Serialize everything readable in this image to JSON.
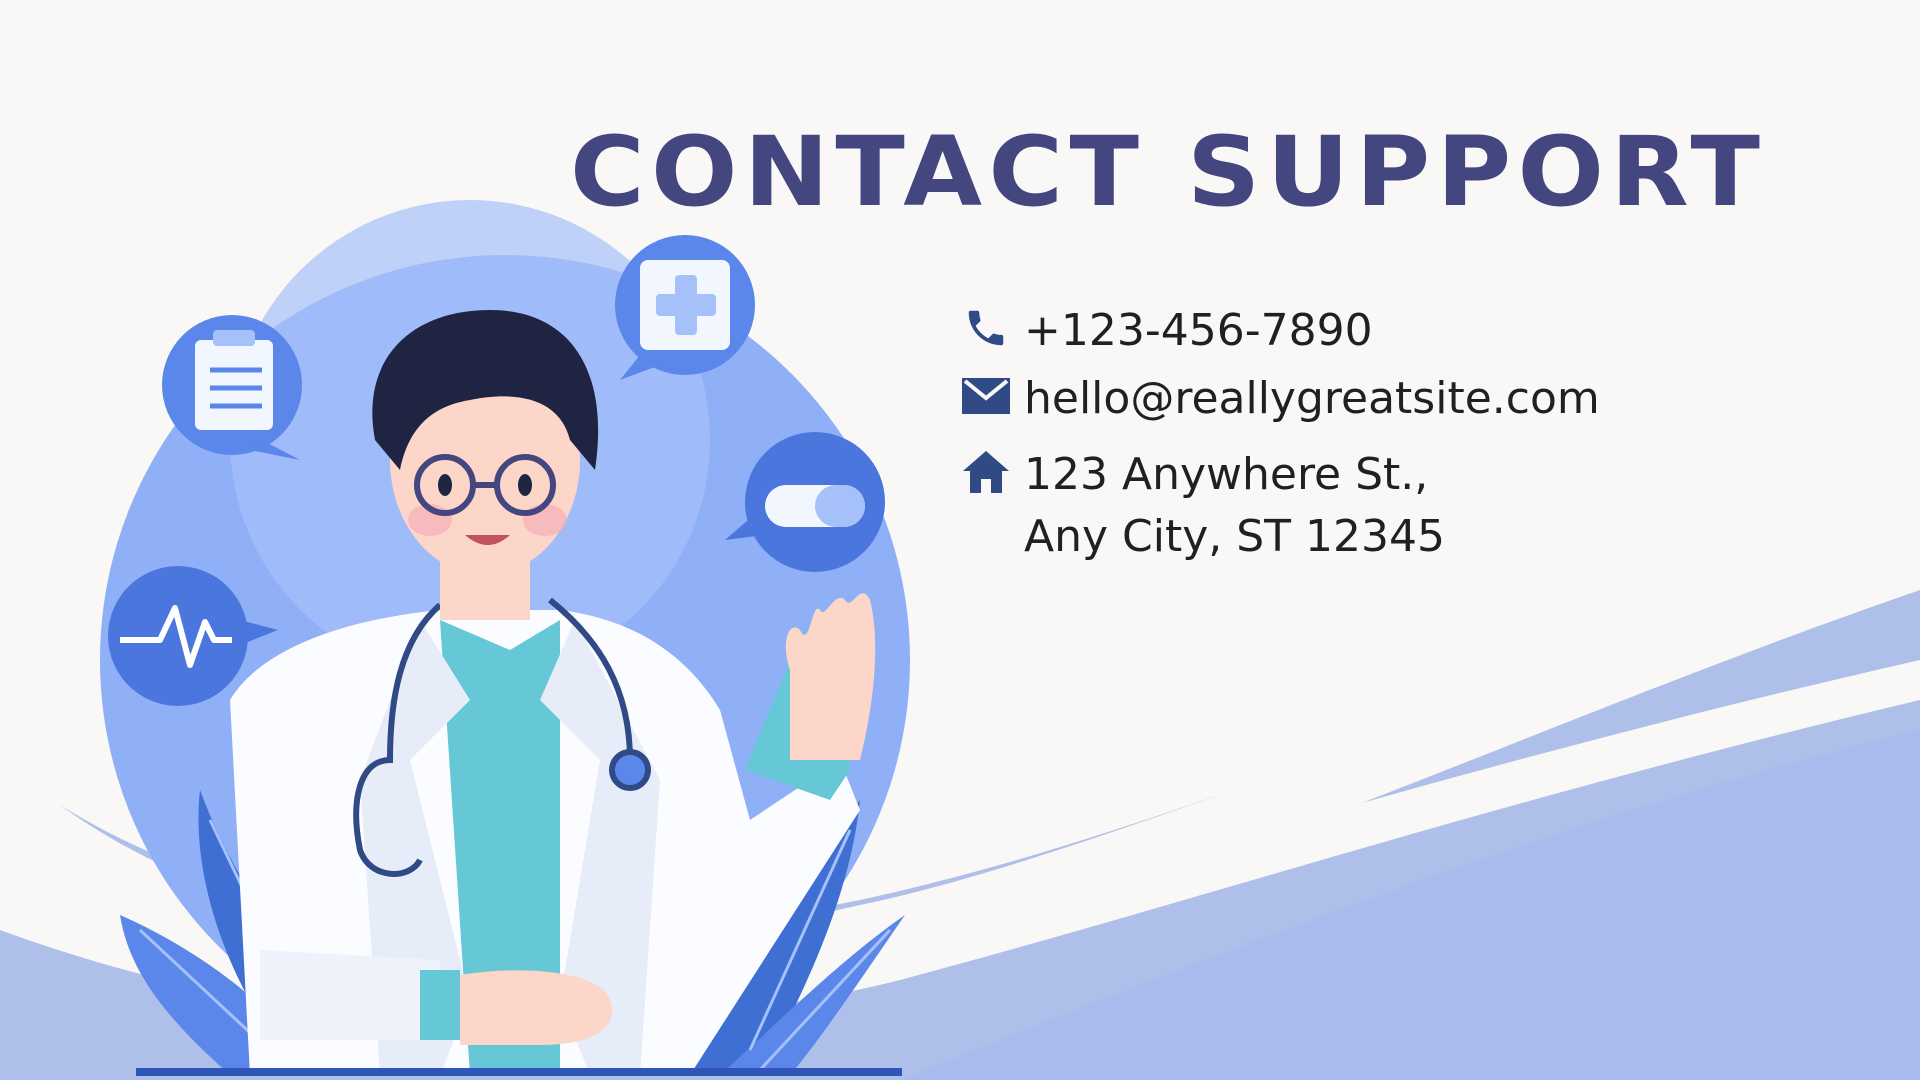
{
  "title": "Contact Support",
  "contacts": {
    "phone": {
      "icon": "phone-icon",
      "text": "+123-456-7890"
    },
    "email": {
      "icon": "mail-icon",
      "text": "hello@reallygreatsite.com"
    },
    "address": {
      "icon": "home-icon",
      "line1": "123 Anywhere St.,",
      "line2": "Any City, ST 12345"
    }
  },
  "illustration": {
    "subject": "doctor-waving",
    "bubble_icons": [
      "clipboard-icon",
      "medical-cross-icon",
      "pill-icon",
      "heartbeat-icon"
    ]
  },
  "colors": {
    "background": "#f9f8f7",
    "title": "#43467f",
    "text": "#1f1f24",
    "icon": "#2f4a85",
    "accent_blue": "#5b86ea",
    "light_blue": "#a9bfec",
    "circle_blue": "#8fb0f7"
  }
}
